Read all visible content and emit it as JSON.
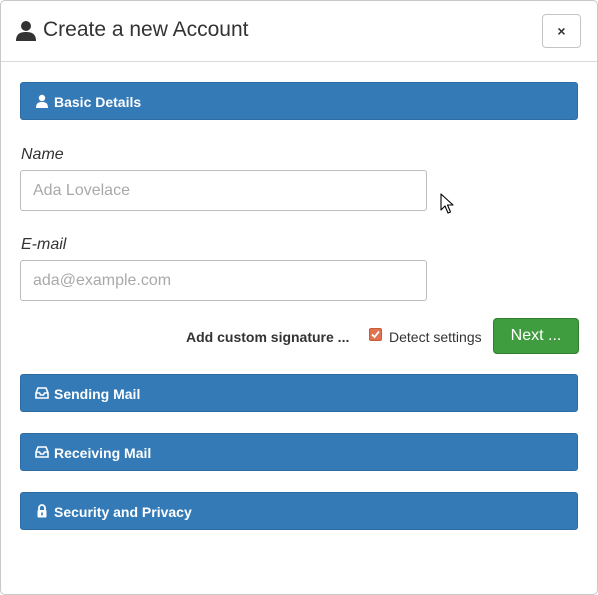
{
  "dialog": {
    "title": "Create a new Account",
    "title_icon": "user-icon",
    "close_label": "×"
  },
  "basic_details": {
    "label": "Basic Details",
    "icon": "user-icon",
    "name_label": "Name",
    "name_placeholder": "Ada Lovelace",
    "name_value": "",
    "email_label": "E-mail",
    "email_placeholder": "ada@example.com",
    "email_value": "",
    "custom_signature_label": "Add custom signature ...",
    "detect_settings_label": "Detect settings",
    "detect_settings_checked": true,
    "next_label": "Next ..."
  },
  "sections": {
    "sending": {
      "label": "Sending Mail",
      "icon": "inbox-tray-icon"
    },
    "receiving": {
      "label": "Receiving Mail",
      "icon": "inbox-tray-icon"
    },
    "security": {
      "label": "Security and Privacy",
      "icon": "lock-icon"
    }
  },
  "colors": {
    "panel_header": "#337ab7",
    "next_button": "#3f9c3f",
    "checkbox": "#e2714d"
  }
}
